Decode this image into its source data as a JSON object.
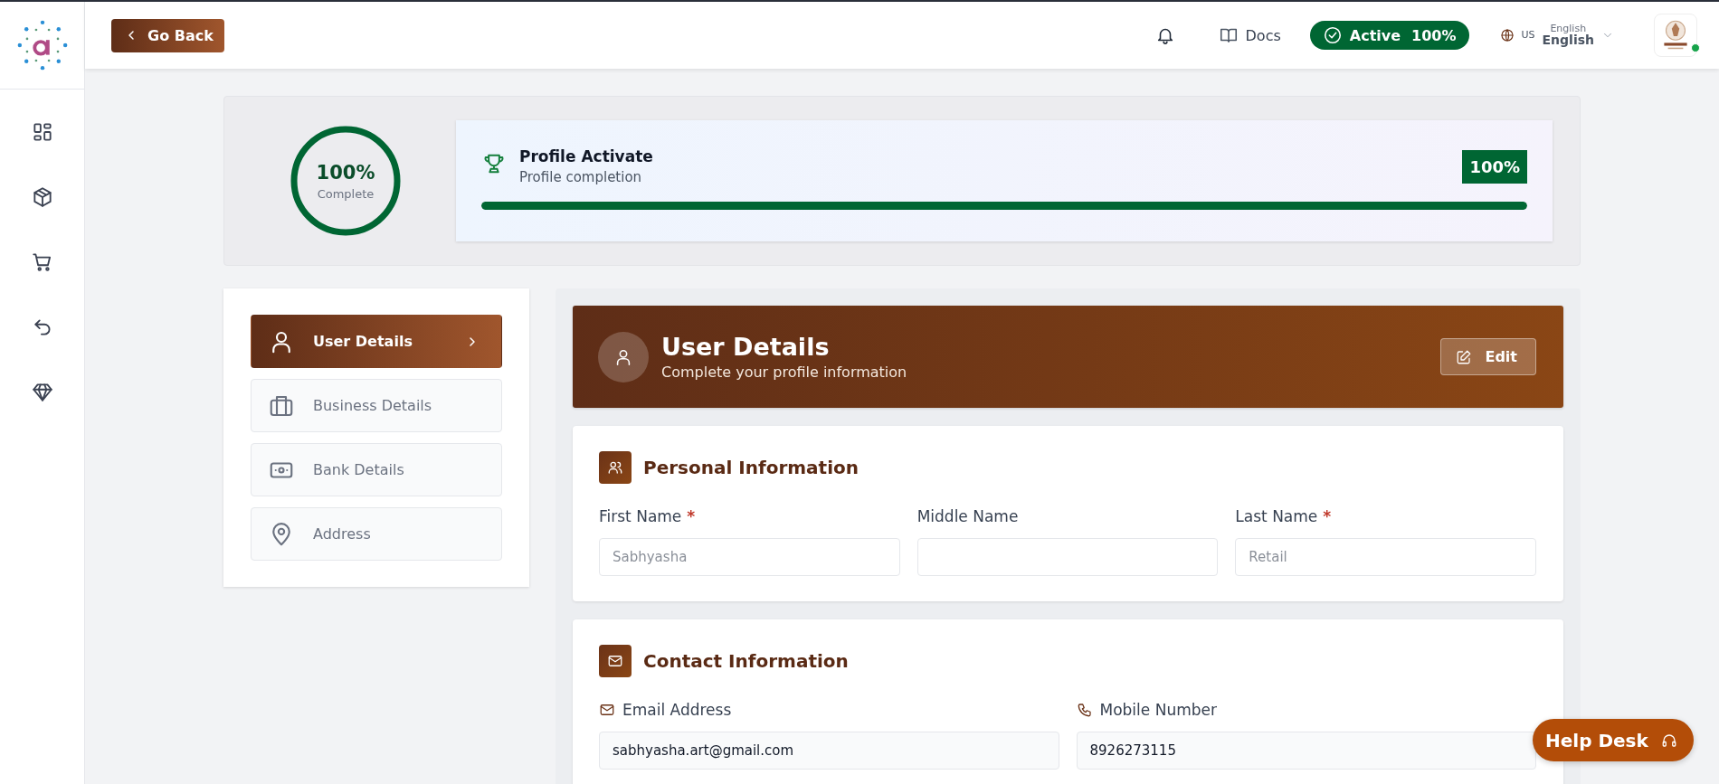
{
  "topbar": {
    "back_button": "Go Back",
    "docs": "Docs",
    "status": {
      "label": "Active",
      "percent": "100%",
      "active": true
    },
    "language": {
      "country": "US",
      "caption": "English",
      "value": "English"
    },
    "user": {
      "online": true
    }
  },
  "sidebar": {
    "items": [
      {
        "kind": "dashboard",
        "selected": false
      },
      {
        "kind": "box",
        "selected": false
      },
      {
        "kind": "cart",
        "selected": false
      },
      {
        "kind": "return",
        "selected": false
      },
      {
        "kind": "diamond",
        "selected": false
      }
    ]
  },
  "progress": {
    "ring": {
      "value": "100%",
      "caption": "Complete",
      "level": 1
    },
    "bar": {
      "title": "Profile Activate",
      "subtitle": "Profile completion",
      "badge": "100%",
      "level": 1
    }
  },
  "steps": [
    {
      "label": "User Details",
      "kind": "user",
      "selected": true
    },
    {
      "label": "Business Details",
      "kind": "briefcase",
      "selected": false
    },
    {
      "label": "Bank Details",
      "kind": "cash",
      "selected": false
    },
    {
      "label": "Address",
      "kind": "pin",
      "selected": false
    }
  ],
  "header": {
    "title": "User Details",
    "subtitle": "Complete your profile information",
    "edit_button": "Edit"
  },
  "sections": [
    {
      "title": "Personal Information",
      "kind": "people",
      "fields": [
        {
          "label": "First Name",
          "mark": "*",
          "placeholder": "Sabhyasha"
        },
        {
          "label": "Middle Name"
        },
        {
          "label": "Last Name",
          "mark": "*",
          "placeholder": "Retail"
        }
      ]
    },
    {
      "title": "Contact Information",
      "kind": "mail",
      "fields": [
        {
          "label": "Email Address",
          "kind": "mail",
          "value": "sabhyasha.art@gmail.com"
        },
        {
          "label": "Mobile Number",
          "kind": "phone",
          "value": "8926273115"
        }
      ]
    }
  ],
  "help_desk": "Help Desk"
}
